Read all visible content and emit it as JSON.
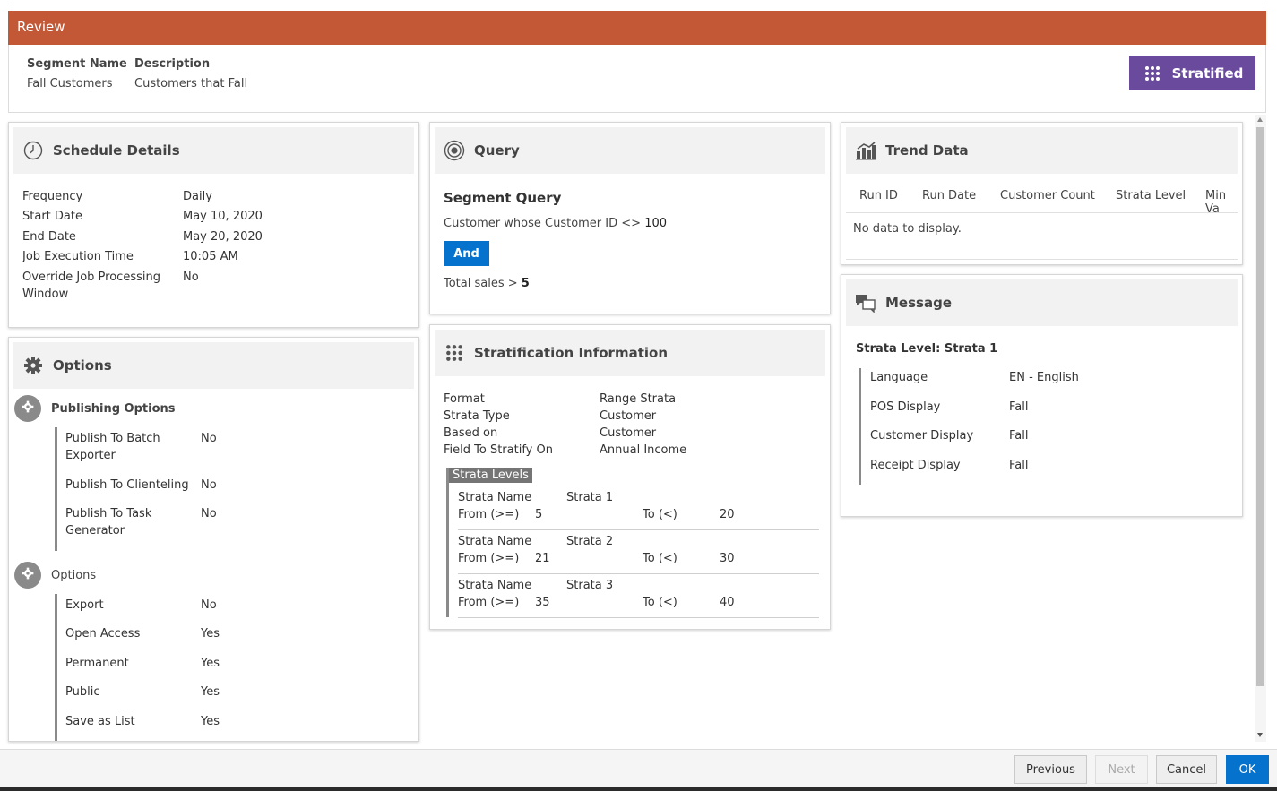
{
  "review": {
    "title": "Review"
  },
  "segment": {
    "name_label": "Segment Name",
    "name_value": "Fall Customers",
    "desc_label": "Description",
    "desc_value": "Customers that Fall",
    "type_button": "Stratified"
  },
  "schedule": {
    "title": "Schedule Details",
    "rows": [
      {
        "k": "Frequency",
        "v": "Daily"
      },
      {
        "k": "Start Date",
        "v": "May 10, 2020"
      },
      {
        "k": "End Date",
        "v": "May 20, 2020"
      },
      {
        "k": "Job Execution Time",
        "v": "10:05 AM"
      },
      {
        "k": "Override Job Processing",
        "k2": "Window",
        "v": "No"
      }
    ]
  },
  "options": {
    "title": "Options",
    "publishing": {
      "title": "Publishing Options",
      "rows": [
        {
          "k": "Publish To Batch",
          "k2": "Exporter",
          "v": "No"
        },
        {
          "k": "Publish To Clienteling",
          "v": "No"
        },
        {
          "k": "Publish To Task",
          "k2": "Generator",
          "v": "No"
        }
      ]
    },
    "general": {
      "title": "Options",
      "rows": [
        {
          "k": "Export",
          "v": "No"
        },
        {
          "k": "Open Access",
          "v": "Yes"
        },
        {
          "k": "Permanent",
          "v": "Yes"
        },
        {
          "k": "Public",
          "v": "Yes"
        },
        {
          "k": "Save as List",
          "v": "Yes"
        }
      ]
    }
  },
  "query": {
    "title": "Query",
    "subtitle": "Segment Query",
    "line1_text": "Customer whose Customer ID <> ",
    "line1_value": "100",
    "and_button": "And",
    "line2_text": "Total sales > ",
    "line2_value": "5"
  },
  "stratification": {
    "title": "Stratification Information",
    "rows": [
      {
        "k": "Format",
        "v": "Range Strata"
      },
      {
        "k": "Strata Type",
        "v": "Customer"
      },
      {
        "k": "Based on",
        "v": "Customer"
      },
      {
        "k": "Field To Stratify On",
        "v": "Annual Income"
      }
    ],
    "levels_label": "Strata Levels",
    "name_label": "Strata Name",
    "from_label": "From (>=)",
    "to_label": "To (<)",
    "levels": [
      {
        "name": "Strata 1",
        "from": "5",
        "to": "20"
      },
      {
        "name": "Strata 2",
        "from": "21",
        "to": "30"
      },
      {
        "name": "Strata 3",
        "from": "35",
        "to": "40"
      }
    ]
  },
  "trend": {
    "title": "Trend Data",
    "columns": [
      "Run ID",
      "Run Date",
      "Customer Count",
      "Strata Level",
      "Min Va"
    ],
    "empty": "No data to display."
  },
  "message": {
    "title": "Message",
    "strata_label": "Strata Level: Strata 1",
    "rows": [
      {
        "k": "Language",
        "v": "EN - English"
      },
      {
        "k": "POS Display",
        "v": "Fall"
      },
      {
        "k": "Customer Display",
        "v": "Fall"
      },
      {
        "k": "Receipt Display",
        "v": "Fall"
      }
    ]
  },
  "footer": {
    "previous": "Previous",
    "next": "Next",
    "cancel": "Cancel",
    "ok": "OK"
  },
  "colors": {
    "header": "#c35837",
    "stratified": "#6a4a9c",
    "primary": "#0572ce"
  }
}
